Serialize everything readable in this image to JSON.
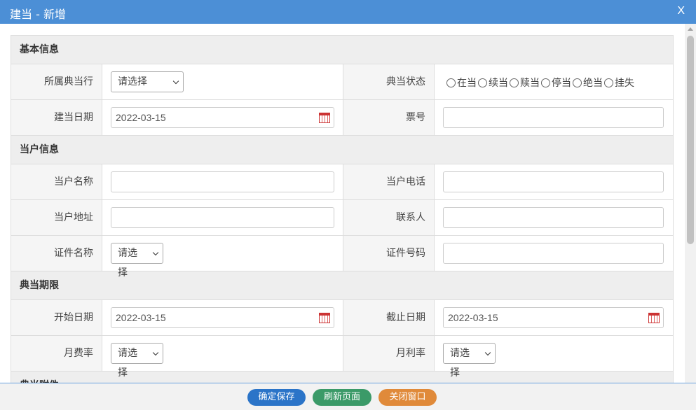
{
  "window": {
    "title": "建当 - 新增",
    "close_label": "X"
  },
  "sections": {
    "basic": {
      "title": "基本信息"
    },
    "customer": {
      "title": "当户信息"
    },
    "term": {
      "title": "典当期限"
    },
    "attachment": {
      "title": "典当附件"
    }
  },
  "basic": {
    "pawnshop_label": "所属典当行",
    "pawnshop_value": "请选择",
    "status_label": "典当状态",
    "status_options": [
      "在当",
      "续当",
      "赎当",
      "停当",
      "绝当",
      "挂失"
    ],
    "date_label": "建当日期",
    "date_value": "2022-03-15",
    "ticket_label": "票号",
    "ticket_value": ""
  },
  "customer": {
    "name_label": "当户名称",
    "name_value": "",
    "phone_label": "当户电话",
    "phone_value": "",
    "address_label": "当户地址",
    "address_value": "",
    "contact_label": "联系人",
    "contact_value": "",
    "id_type_label": "证件名称",
    "id_type_value": "请选择",
    "id_number_label": "证件号码",
    "id_number_value": ""
  },
  "term": {
    "start_label": "开始日期",
    "start_value": "2022-03-15",
    "end_label": "截止日期",
    "end_value": "2022-03-15",
    "fee_rate_label": "月费率",
    "fee_rate_value": "请选择",
    "interest_rate_label": "月利率",
    "interest_rate_value": "请选择"
  },
  "footer": {
    "save_label": "确定保存",
    "refresh_label": "刷新页面",
    "close_label": "关闭窗口"
  },
  "colors": {
    "titlebar": "#4c8fd6",
    "save": "#2b74c8",
    "refresh": "#3b9a68",
    "close": "#e08a3a"
  },
  "icons": {
    "date_picker": "calendar-icon"
  }
}
